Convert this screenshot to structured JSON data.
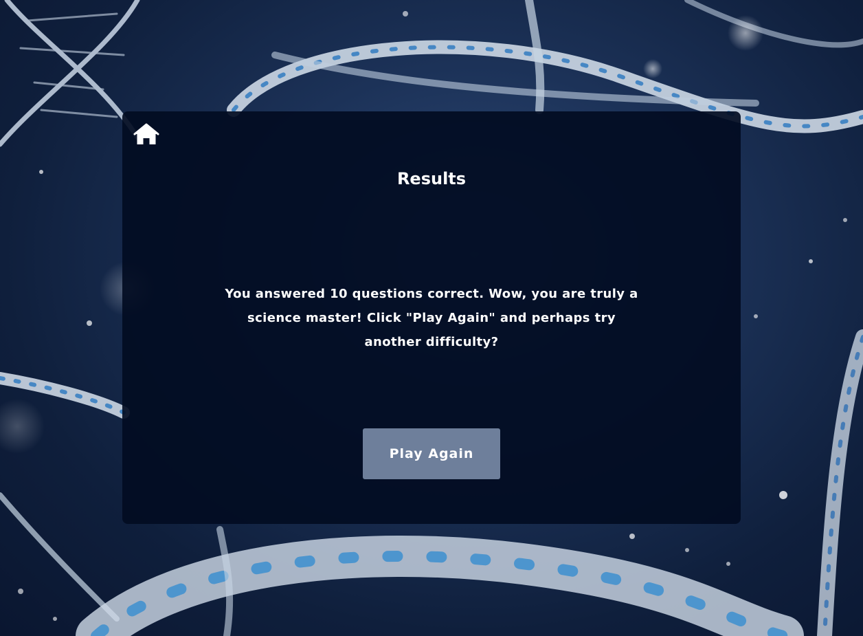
{
  "page": {
    "title": "Results",
    "message": "You answered 10 questions correct. Wow, you are truly a science master! Click \"Play Again\" and perhaps try another difficulty?",
    "play_again_label": "Play Again",
    "home_icon": "home-icon"
  },
  "colors": {
    "card_background": "#020c22",
    "button_background": "#6e7f9b",
    "text": "#ffffff"
  }
}
